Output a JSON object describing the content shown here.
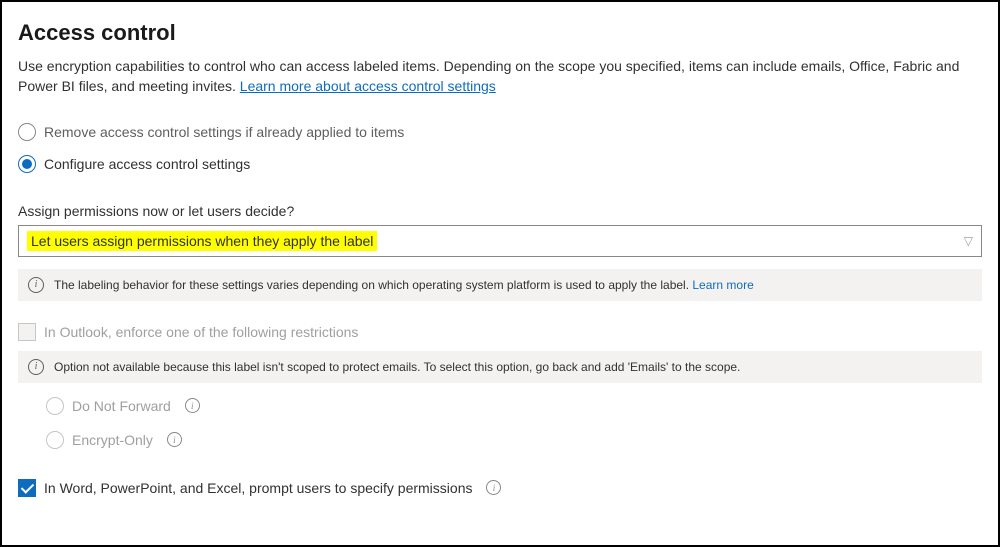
{
  "title": "Access control",
  "description_part1": "Use encryption capabilities to control who can access labeled items. Depending on the scope you specified, items can include emails, Office, Fabric and Power BI files, and meeting invites. ",
  "description_link": "Learn more about access control settings",
  "mode": {
    "remove": "Remove access control settings if already applied to items",
    "configure": "Configure access control settings",
    "selected": "configure"
  },
  "assign_label": "Assign permissions now or let users decide?",
  "dropdown_value": "Let users assign permissions when they apply the label",
  "info1_text": "The labeling behavior for these settings varies depending on which operating system platform is used to apply the label. ",
  "info1_link": "Learn more",
  "outlook": {
    "label": "In Outlook, enforce one of the following restrictions",
    "info": "Option not available because this label isn't scoped to protect emails. To select this option, go back and add 'Emails' to the scope.",
    "opt1": "Do Not Forward",
    "opt2": "Encrypt-Only"
  },
  "office_cb": "In Word, PowerPoint, and Excel, prompt users to specify permissions"
}
